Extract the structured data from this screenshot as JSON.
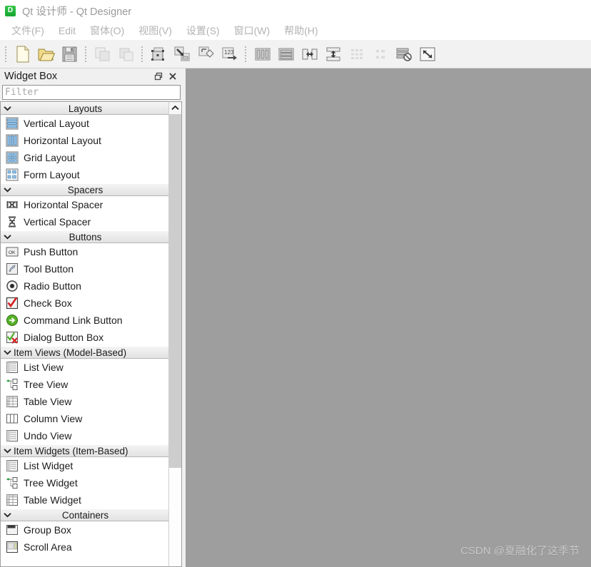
{
  "titlebar": {
    "icon": "qt-designer-app-icon",
    "icon_letter": "D",
    "title": "Qt 设计师 - Qt Designer"
  },
  "menubar": {
    "items": [
      {
        "label": "文件(F)"
      },
      {
        "label": "Edit"
      },
      {
        "label": "窗体(O)"
      },
      {
        "label": "视图(V)"
      },
      {
        "label": "设置(S)"
      },
      {
        "label": "窗口(W)"
      },
      {
        "label": "帮助(H)"
      }
    ]
  },
  "toolbar": {
    "groups": [
      {
        "buttons": [
          {
            "name": "new-form-button",
            "icon": "new-file-icon",
            "enabled": true
          },
          {
            "name": "open-form-button",
            "icon": "open-folder-icon",
            "enabled": true
          },
          {
            "name": "save-form-button",
            "icon": "save-floppy-icon",
            "enabled": true
          }
        ]
      },
      {
        "buttons": [
          {
            "name": "copy-button",
            "icon": "copy-icon",
            "enabled": false
          },
          {
            "name": "paste-button",
            "icon": "paste-icon",
            "enabled": false
          }
        ]
      },
      {
        "buttons": [
          {
            "name": "edit-widgets-button",
            "icon": "edit-widgets-icon",
            "enabled": true
          },
          {
            "name": "edit-signals-slots-button",
            "icon": "edit-signals-slots-icon",
            "enabled": true
          },
          {
            "name": "edit-buddies-button",
            "icon": "edit-buddies-icon",
            "enabled": true
          },
          {
            "name": "edit-tab-order-button",
            "icon": "edit-tab-order-icon",
            "enabled": true
          }
        ]
      },
      {
        "buttons": [
          {
            "name": "layout-horizontally-button",
            "icon": "layout-horizontal-icon",
            "enabled": true
          },
          {
            "name": "layout-vertically-button",
            "icon": "layout-vertical-icon",
            "enabled": true
          },
          {
            "name": "layout-splitter-horizontal-button",
            "icon": "splitter-horizontal-icon",
            "enabled": true
          },
          {
            "name": "layout-splitter-vertical-button",
            "icon": "splitter-vertical-icon",
            "enabled": true
          },
          {
            "name": "layout-grid-button",
            "icon": "layout-grid-icon",
            "enabled": false
          },
          {
            "name": "layout-form-button",
            "icon": "layout-form-icon",
            "enabled": false
          },
          {
            "name": "break-layout-button",
            "icon": "break-layout-icon",
            "enabled": true
          },
          {
            "name": "adjust-size-button",
            "icon": "adjust-size-icon",
            "enabled": true
          }
        ]
      }
    ]
  },
  "widget_box": {
    "title": "Widget Box",
    "float_button_icon": "restore-float-icon",
    "close_button_icon": "close-icon",
    "filter": {
      "value": "",
      "placeholder": "Filter"
    },
    "scrollbar": {
      "up_arrow_icon": "chevron-up-icon"
    },
    "sections": [
      {
        "label": "Layouts",
        "expanded": true,
        "align": "center",
        "items": [
          {
            "label": "Vertical Layout",
            "icon": "vertical-layout-icon"
          },
          {
            "label": "Horizontal Layout",
            "icon": "horizontal-layout-icon"
          },
          {
            "label": "Grid Layout",
            "icon": "grid-layout-icon"
          },
          {
            "label": "Form Layout",
            "icon": "form-layout-icon"
          }
        ]
      },
      {
        "label": "Spacers",
        "expanded": true,
        "align": "center",
        "items": [
          {
            "label": "Horizontal Spacer",
            "icon": "horizontal-spacer-icon"
          },
          {
            "label": "Vertical Spacer",
            "icon": "vertical-spacer-icon"
          }
        ]
      },
      {
        "label": "Buttons",
        "expanded": true,
        "align": "center",
        "items": [
          {
            "label": "Push Button",
            "icon": "push-button-icon"
          },
          {
            "label": "Tool Button",
            "icon": "tool-button-icon"
          },
          {
            "label": "Radio Button",
            "icon": "radio-button-icon"
          },
          {
            "label": "Check Box",
            "icon": "check-box-icon"
          },
          {
            "label": "Command Link Button",
            "icon": "command-link-button-icon"
          },
          {
            "label": "Dialog Button Box",
            "icon": "dialog-button-box-icon"
          }
        ]
      },
      {
        "label": "Item Views (Model-Based)",
        "expanded": true,
        "align": "left",
        "items": [
          {
            "label": "List View",
            "icon": "list-view-icon"
          },
          {
            "label": "Tree View",
            "icon": "tree-view-icon"
          },
          {
            "label": "Table View",
            "icon": "table-view-icon"
          },
          {
            "label": "Column View",
            "icon": "column-view-icon"
          },
          {
            "label": "Undo View",
            "icon": "undo-view-icon"
          }
        ]
      },
      {
        "label": "Item Widgets (Item-Based)",
        "expanded": true,
        "align": "left",
        "items": [
          {
            "label": "List Widget",
            "icon": "list-widget-icon"
          },
          {
            "label": "Tree Widget",
            "icon": "tree-widget-icon"
          },
          {
            "label": "Table Widget",
            "icon": "table-widget-icon"
          }
        ]
      },
      {
        "label": "Containers",
        "expanded": true,
        "align": "center",
        "items": [
          {
            "label": "Group Box",
            "icon": "group-box-icon"
          },
          {
            "label": "Scroll Area",
            "icon": "scroll-area-icon"
          }
        ]
      }
    ]
  },
  "canvas": {
    "watermark": "CSDN @夏融化了这季节"
  },
  "colors": {
    "canvas_bg": "#9e9e9e",
    "chrome_bg": "#f0f0f0",
    "tree_bg": "#ffffff",
    "title_text": "#9a9a9a",
    "menu_text": "#b3b3b3",
    "accent_green": "#15a531"
  }
}
